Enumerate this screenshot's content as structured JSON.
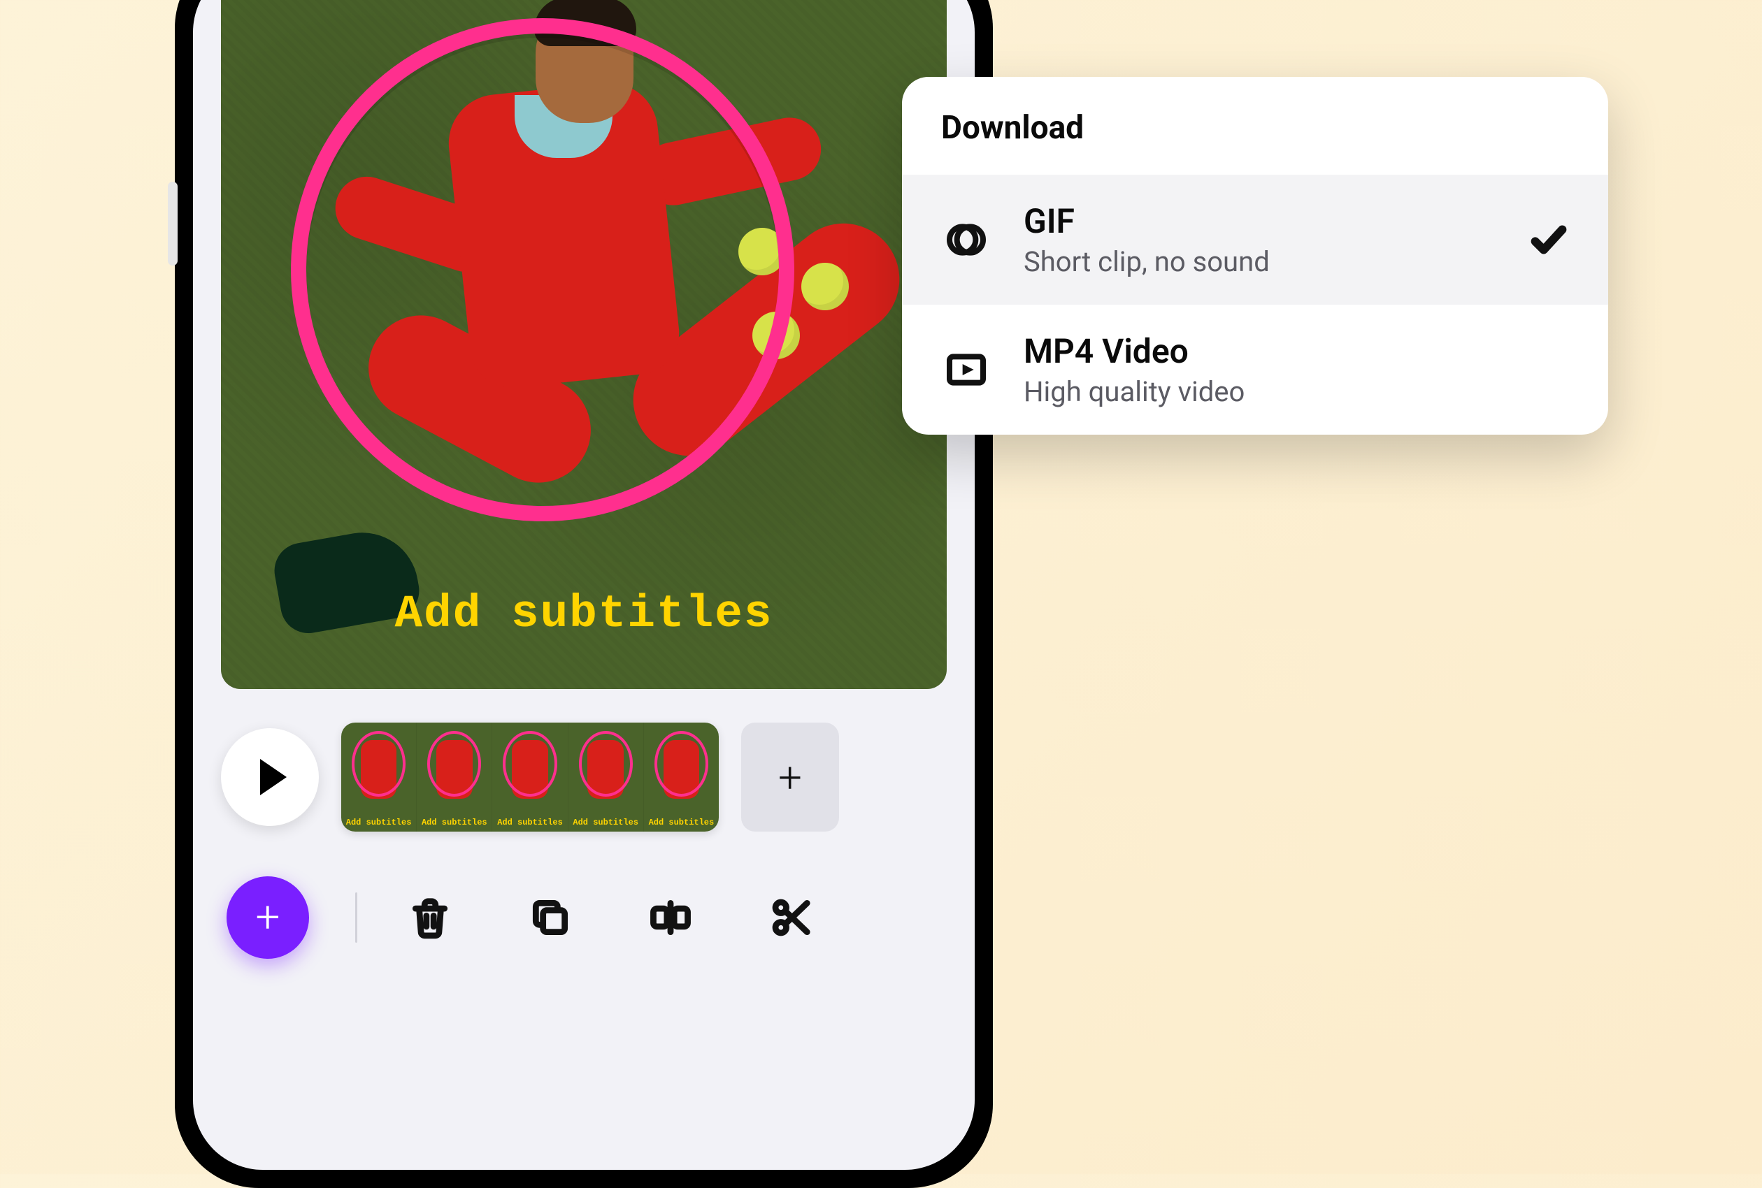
{
  "canvas": {
    "subtitle_text": "Add subtitles"
  },
  "timeline": {
    "thumb_label": "Add subtitles",
    "frame_count": 5
  },
  "download_menu": {
    "title": "Download",
    "options": [
      {
        "title": "GIF",
        "subtitle": "Short clip, no sound",
        "selected": true,
        "icon": "gif"
      },
      {
        "title": "MP4 Video",
        "subtitle": "High quality video",
        "selected": false,
        "icon": "video"
      }
    ]
  },
  "colors": {
    "accent_purple": "#7a1fff",
    "subtitle_yellow": "#ffd400",
    "hoop_pink": "#ff2f8e",
    "suit_red": "#d8201a",
    "grass_green": "#4a632a"
  }
}
